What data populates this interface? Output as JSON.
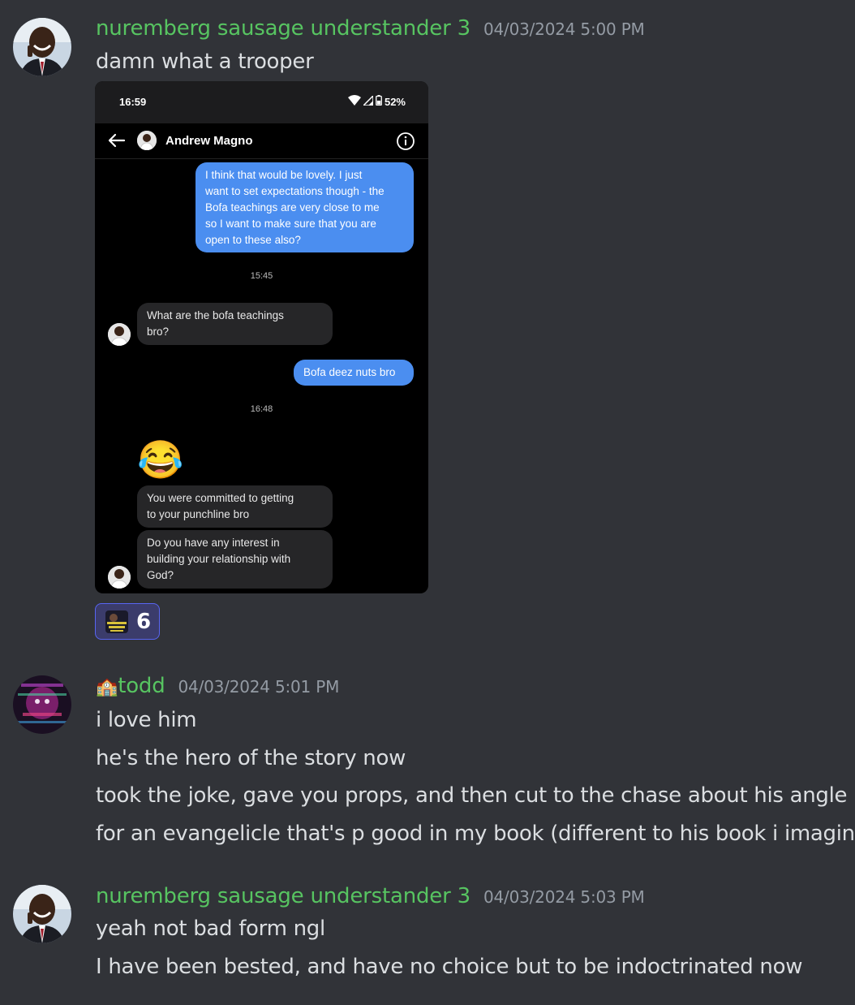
{
  "messages": [
    {
      "username": "nuremberg sausage understander 3",
      "timestamp": "04/03/2024 5:00 PM",
      "lines": [
        "damn what a trooper"
      ],
      "reaction": {
        "emoji": "custom-server-emoji",
        "count": "6"
      }
    },
    {
      "username_prefix": "🏫",
      "username": "todd",
      "timestamp": "04/03/2024 5:01 PM",
      "lines": [
        "i love him",
        "he's the hero of the story now",
        "took the joke, gave you props, and then cut to the chase about his angle",
        "for an evangelicle that's p good in my book (different to his book i imagine)"
      ]
    },
    {
      "username": "nuremberg sausage understander 3",
      "timestamp": "04/03/2024 5:03 PM",
      "lines": [
        "yeah not bad form ngl",
        "I have been bested, and have no choice but to be indoctrinated now"
      ]
    }
  ],
  "screenshot": {
    "status_time": "16:59",
    "battery": "52%",
    "contact_name": "Andrew Magno",
    "bubbles": [
      {
        "dir": "out",
        "lines": [
          "I think that would be lovely. I just",
          "want to set expectations though - the",
          "Bofa teachings are very close to me",
          "so I want to make sure that you are",
          "open to these also?"
        ]
      },
      {
        "sep": "15:45"
      },
      {
        "dir": "in",
        "lines": [
          "What are the bofa teachings",
          "bro?"
        ]
      },
      {
        "dir": "out",
        "lines": [
          "Bofa deez nuts bro"
        ]
      },
      {
        "sep": "16:48"
      },
      {
        "emoji": "😂"
      },
      {
        "dir": "in",
        "lines": [
          "You were committed to getting",
          "to your punchline bro"
        ]
      },
      {
        "dir": "in",
        "lines": [
          "Do you have any interest in",
          "building your relationship with",
          "God?"
        ]
      }
    ]
  },
  "colors": {
    "background": "#313338",
    "username": "#57c461",
    "timestamp": "#949ba4",
    "text": "#dbdee1",
    "out_bubble": "#4b8ef0",
    "in_bubble": "#262628",
    "reaction_bg": "#3b3c6b",
    "reaction_border": "#5865f2"
  }
}
